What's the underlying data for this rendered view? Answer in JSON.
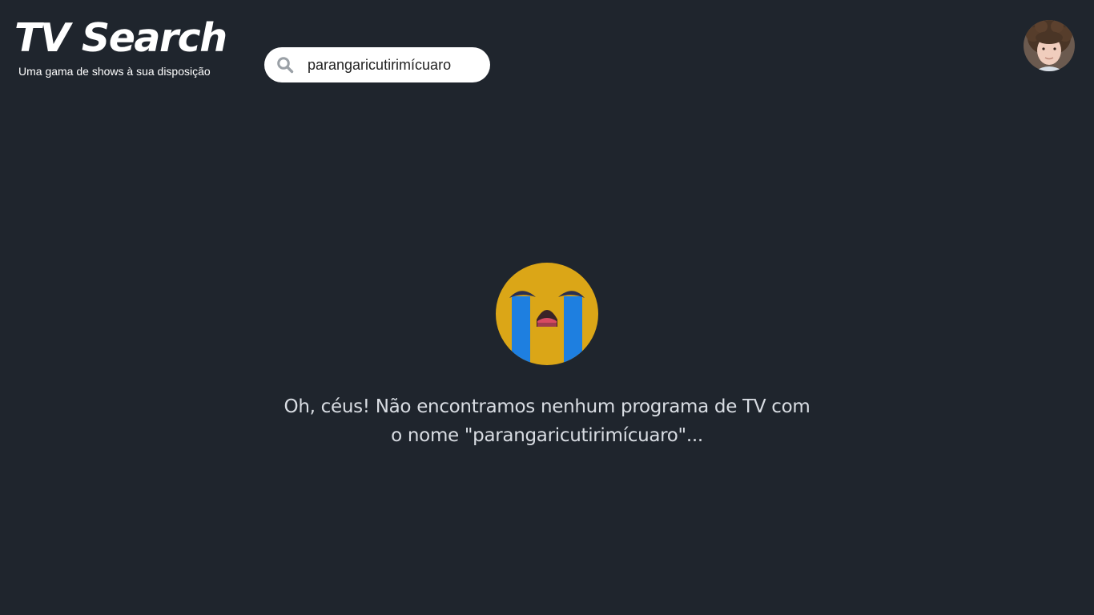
{
  "header": {
    "app_title": "TV Search",
    "tagline": "Uma gama de shows à sua disposição"
  },
  "search": {
    "value": "parangaricutirimícuaro",
    "icon": "search-icon"
  },
  "user": {
    "avatar_icon": "user-avatar"
  },
  "empty_state": {
    "icon": "loudly-crying-face-icon",
    "message": "Oh, céus! Não encontramos nenhum programa de TV com o nome \"parangaricutirimícuaro\"..."
  },
  "colors": {
    "background": "#1f252d",
    "search_background": "#ffffff",
    "emoji_face": "#dba617",
    "emoji_tears": "#1e7fe0"
  }
}
